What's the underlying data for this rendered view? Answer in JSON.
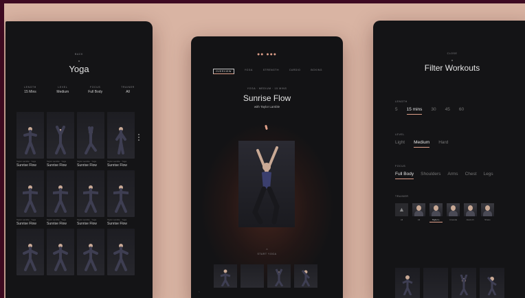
{
  "colors": {
    "background": "#d9b4a3",
    "frame": "#3e0a22",
    "panel": "#141416",
    "accent": "#e0a08a"
  },
  "left": {
    "nav_label": "Back",
    "title": "Yoga",
    "meta": [
      {
        "label": "Length",
        "value": "15 Mins"
      },
      {
        "label": "Level",
        "value": "Medium"
      },
      {
        "label": "Focus",
        "value": "Full Body"
      },
      {
        "label": "Trainer",
        "value": "All"
      }
    ],
    "workouts": [
      {
        "subtitle": "Taylor Lamble · Yoga",
        "title": "Sunrise Flow"
      },
      {
        "subtitle": "Taylor Lamble · Yoga",
        "title": "Sunrise Flow"
      },
      {
        "subtitle": "Taylor Lamble · Yoga",
        "title": "Sunrise Flow"
      },
      {
        "subtitle": "Taylor Lamble · Yoga",
        "title": "Sunrise Flow"
      },
      {
        "subtitle": "Taylor Lamble · Yoga",
        "title": "Sunrise Flow"
      },
      {
        "subtitle": "Taylor Lamble · Yoga",
        "title": "Sunrise Flow"
      },
      {
        "subtitle": "Taylor Lamble · Yoga",
        "title": "Sunrise Flow"
      },
      {
        "subtitle": "Taylor Lamble · Yoga",
        "title": "Sunrise Flow"
      }
    ]
  },
  "center": {
    "status_dots": "●● ●●●",
    "tabs": [
      "Overview",
      "Yoga",
      "Strength",
      "Cardio",
      "Boxing"
    ],
    "subtitle": "Yoga · Medium · 15 mins",
    "title": "Sunrise Flow",
    "instructor": "with Taylor Lamble",
    "up_arrow": "⌃",
    "bottom_label": "Start Yoga",
    "cursor": "⌞"
  },
  "right": {
    "nav_label": "Close",
    "title": "Filter Workouts",
    "length": {
      "label": "Length",
      "options": [
        "5",
        "15 mins",
        "30",
        "45",
        "60"
      ],
      "selected": 1
    },
    "level": {
      "label": "Level",
      "options": [
        "Light",
        "Medium",
        "Hard"
      ],
      "selected": 1
    },
    "focus": {
      "label": "Focus",
      "options": [
        "Full Body",
        "Shoulders",
        "Arms",
        "Chest",
        "Legs"
      ],
      "selected": 0
    },
    "trainer": {
      "label": "Trainer",
      "options": [
        {
          "name": "All",
          "icon": "triangle-icon"
        },
        {
          "name": "Ali"
        },
        {
          "name": "Taylor L."
        },
        {
          "name": "Amanda"
        },
        {
          "name": "Alexis R."
        },
        {
          "name": "Shane"
        }
      ],
      "selected": 2
    }
  }
}
